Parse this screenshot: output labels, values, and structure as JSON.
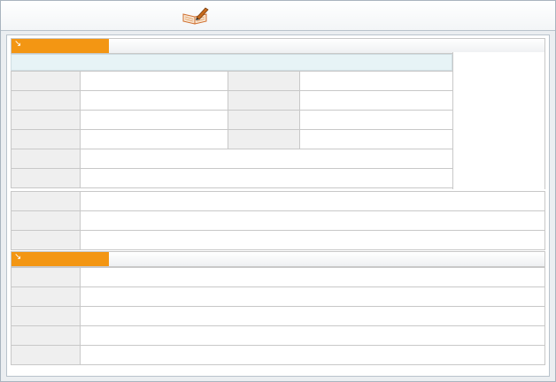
{
  "toolbar": {
    "icon": "book-pen-icon"
  },
  "section_1": {
    "header_label": "",
    "strip_text": "",
    "grid_rows": [
      {
        "label_a": "",
        "value_a": "",
        "label_b": "",
        "value_b": ""
      },
      {
        "label_a": "",
        "value_a": "",
        "label_b": "",
        "value_b": ""
      },
      {
        "label_a": "",
        "value_a": "",
        "label_b": "",
        "value_b": ""
      },
      {
        "label_a": "",
        "value_a": "",
        "label_b": "",
        "value_b": ""
      }
    ],
    "mid_rows": [
      {
        "label": "",
        "value": ""
      },
      {
        "label": "",
        "value": ""
      }
    ],
    "wide_rows": [
      {
        "label": "",
        "value": ""
      },
      {
        "label": "",
        "value": ""
      },
      {
        "label": "",
        "value": ""
      }
    ]
  },
  "section_2": {
    "header_label": "",
    "rows": [
      {
        "label": "",
        "value": ""
      },
      {
        "label": "",
        "value": ""
      },
      {
        "label": "",
        "value": ""
      },
      {
        "label": "",
        "value": ""
      },
      {
        "label": "",
        "value": ""
      }
    ]
  },
  "colors": {
    "accent": "#f39613",
    "strip": "#e7f3f6",
    "label_bg": "#efefef",
    "border": "#c8c8c8"
  }
}
